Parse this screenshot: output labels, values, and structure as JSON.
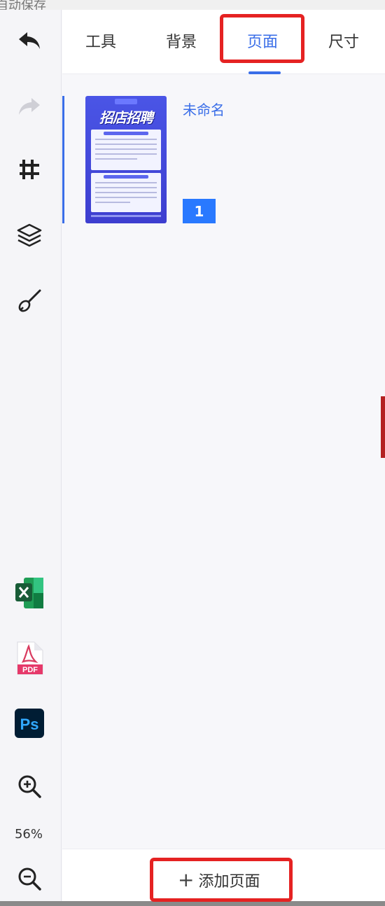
{
  "top_strip_text": "自动保存",
  "sidebar": {
    "undo_icon": "undo-icon",
    "redo_icon": "redo-icon",
    "crop_icon": "crop-icon",
    "layers_icon": "layers-icon",
    "brush_icon": "brush-icon",
    "excel_icon": "excel-export-icon",
    "pdf_label": "PDF",
    "ps_label": "Ps",
    "zoom_level": "56%"
  },
  "tabs": [
    {
      "label": "工具"
    },
    {
      "label": "背景"
    },
    {
      "label": "页面",
      "active": true
    },
    {
      "label": "尺寸"
    }
  ],
  "page_item": {
    "name": "未命名",
    "number": "1",
    "thumbnail_headline": "招店招聘"
  },
  "bottom": {
    "add_page_label": "添加页面"
  },
  "colors": {
    "accent": "#3a6ee8",
    "highlight": "#e52222",
    "badge": "#2979ff"
  }
}
